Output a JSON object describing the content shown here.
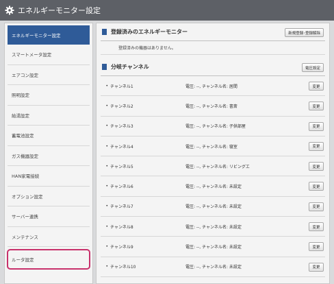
{
  "titlebar": {
    "title": "エネルギーモニター設定",
    "icon": "gear-icon"
  },
  "sidebar": {
    "items": [
      {
        "label": "エネルギーモニター設定"
      },
      {
        "label": "スマートメータ設定"
      },
      {
        "label": "エアコン設定"
      },
      {
        "label": "照明設定"
      },
      {
        "label": "給湯設定"
      },
      {
        "label": "蓄電池設定"
      },
      {
        "label": "ガス機器設定"
      },
      {
        "label": "HAN家電接続"
      },
      {
        "label": "オプション設定"
      },
      {
        "label": "サーバー連携"
      },
      {
        "label": "メンテナンス"
      },
      {
        "label": "ルータ設定"
      }
    ]
  },
  "registered": {
    "title": "登録済みのエネルギーモニター",
    "button": "新規登録･登録解除",
    "message": "登録済みの機器はありません。"
  },
  "branch": {
    "title": "分岐チャンネル",
    "button": "電圧設定",
    "change_label": "変更",
    "channels": [
      {
        "name": "チャンネル1",
        "info": "電圧: --,  チャンネル名: 居間"
      },
      {
        "name": "チャンネル2",
        "info": "電圧: --,  チャンネル名: 書斎"
      },
      {
        "name": "チャンネル3",
        "info": "電圧: --,  チャンネル名: 子供部屋"
      },
      {
        "name": "チャンネル4",
        "info": "電圧: --,  チャンネル名: 寝室"
      },
      {
        "name": "チャンネル5",
        "info": "電圧: --,  チャンネル名: リビングエ"
      },
      {
        "name": "チャンネル6",
        "info": "電圧: --,  チャンネル名: 未設定"
      },
      {
        "name": "チャンネル7",
        "info": "電圧: --,  チャンネル名: 未設定"
      },
      {
        "name": "チャンネル8",
        "info": "電圧: --,  チャンネル名: 未設定"
      },
      {
        "name": "チャンネル9",
        "info": "電圧: --,  チャンネル名: 未設定"
      },
      {
        "name": "チャンネル10",
        "info": "電圧: --,  チャンネル名: 未設定"
      }
    ]
  },
  "colors": {
    "accent": "#2f5b98",
    "titlebar": "#5d6066",
    "highlight": "#c8306b"
  }
}
